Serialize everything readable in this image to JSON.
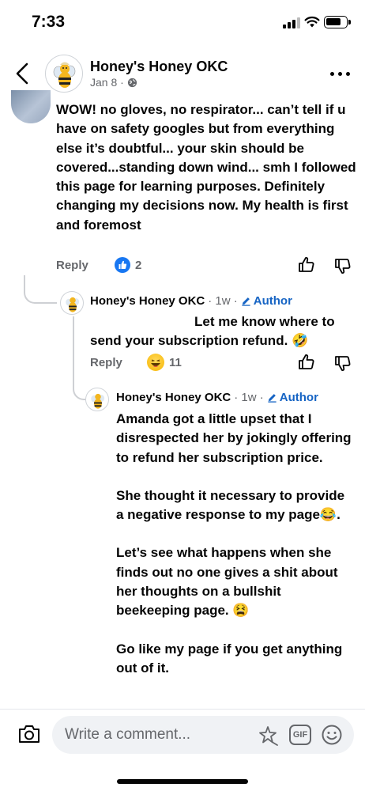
{
  "status_bar": {
    "time": "7:33"
  },
  "header": {
    "page_name": "Honey's Honey OKC",
    "post_date": "Jan 8 · "
  },
  "comments": [
    {
      "text": "WOW! no gloves, no respirator... can’t tell if u have on safety googles but from everything else it’s doubtful... your skin should be covered...standing down wind... smh I followed this page for learning purposes. Definitely changing my decisions now. My health is first and foremost",
      "reply_label": "Reply",
      "reaction_count": "2"
    },
    {
      "author": "Honey's Honey OKC",
      "time": " · 1w · ",
      "badge": "Author",
      "text": "Let me know where to send your subscription refund. 🤣",
      "reply_label": "Reply",
      "reaction_count": "11"
    },
    {
      "author": "Honey's Honey OKC",
      "time": " · 1w · ",
      "badge": "Author",
      "paragraphs": [
        "Amanda got a little upset that I disrespected her by jokingly offering to refund her subscription price.",
        "She thought it necessary to provide a negative response to my page😂.",
        "Let’s see what happens when she finds out no one gives a shit about her thoughts on a bullshit beekeeping page. 😫",
        "Go like my page if you get anything out of it."
      ]
    }
  ],
  "composer": {
    "placeholder": "Write a comment...",
    "gif_label": "GIF"
  },
  "icons": {
    "back": "chevron-left-icon",
    "more": "more-dots-icon",
    "globe": "globe-icon",
    "like": "thumbs-up-icon",
    "dislike": "thumbs-down-icon",
    "camera": "camera-icon",
    "sticker": "sticker-icon",
    "emoji": "emoji-icon",
    "pencil": "pencil-icon"
  },
  "colors": {
    "facebook_blue": "#1877f2",
    "author_blue": "#1664c4",
    "secondary_text": "#65676b"
  }
}
